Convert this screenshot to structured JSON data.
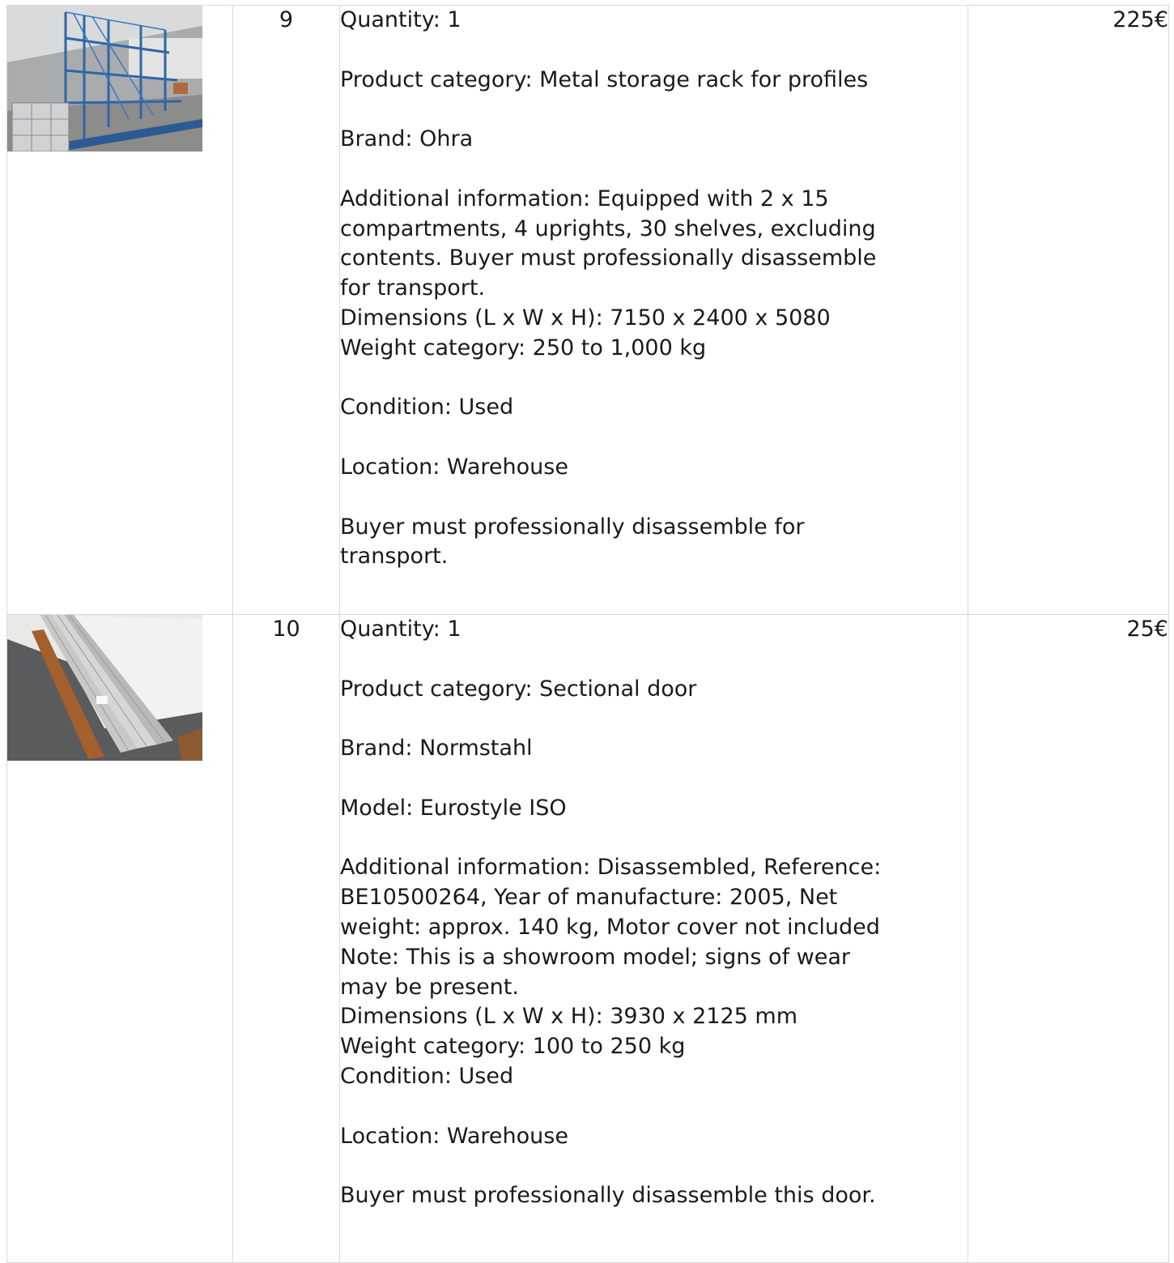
{
  "lots": [
    {
      "number": "9",
      "image_alt": "Metal storage rack in warehouse",
      "description": [
        [
          "Quantity: 1"
        ],
        [
          "Product category: Metal storage rack for profiles"
        ],
        [
          "Brand: Ohra"
        ],
        [
          "Additional information: Equipped with 2 x 15",
          "compartments, 4 uprights, 30 shelves, excluding",
          "contents. Buyer must professionally disassemble",
          "for transport.",
          "Dimensions (L x W x H): 7150 x 2400 x 5080",
          "Weight category: 250 to 1,000 kg"
        ],
        [
          "Condition: Used"
        ],
        [
          "Location: Warehouse"
        ],
        [
          "Buyer must professionally disassemble for",
          "transport."
        ]
      ],
      "price": "225€"
    },
    {
      "number": "10",
      "image_alt": "Disassembled sectional door panels",
      "description": [
        [
          "Quantity: 1"
        ],
        [
          "Product category: Sectional door"
        ],
        [
          "Brand: Normstahl"
        ],
        [
          "Model: Eurostyle ISO"
        ],
        [
          "Additional information: Disassembled, Reference:",
          "BE10500264, Year of manufacture: 2005, Net",
          "weight: approx. 140 kg, Motor cover not included",
          "Note: This is a showroom model; signs of wear",
          "may be present.",
          "Dimensions (L x W x H): 3930 x 2125 mm",
          "Weight category: 100 to 250 kg",
          "Condition: Used"
        ],
        [
          "Location: Warehouse"
        ],
        [
          "Buyer must professionally disassemble this door."
        ]
      ],
      "price": "25€"
    }
  ]
}
